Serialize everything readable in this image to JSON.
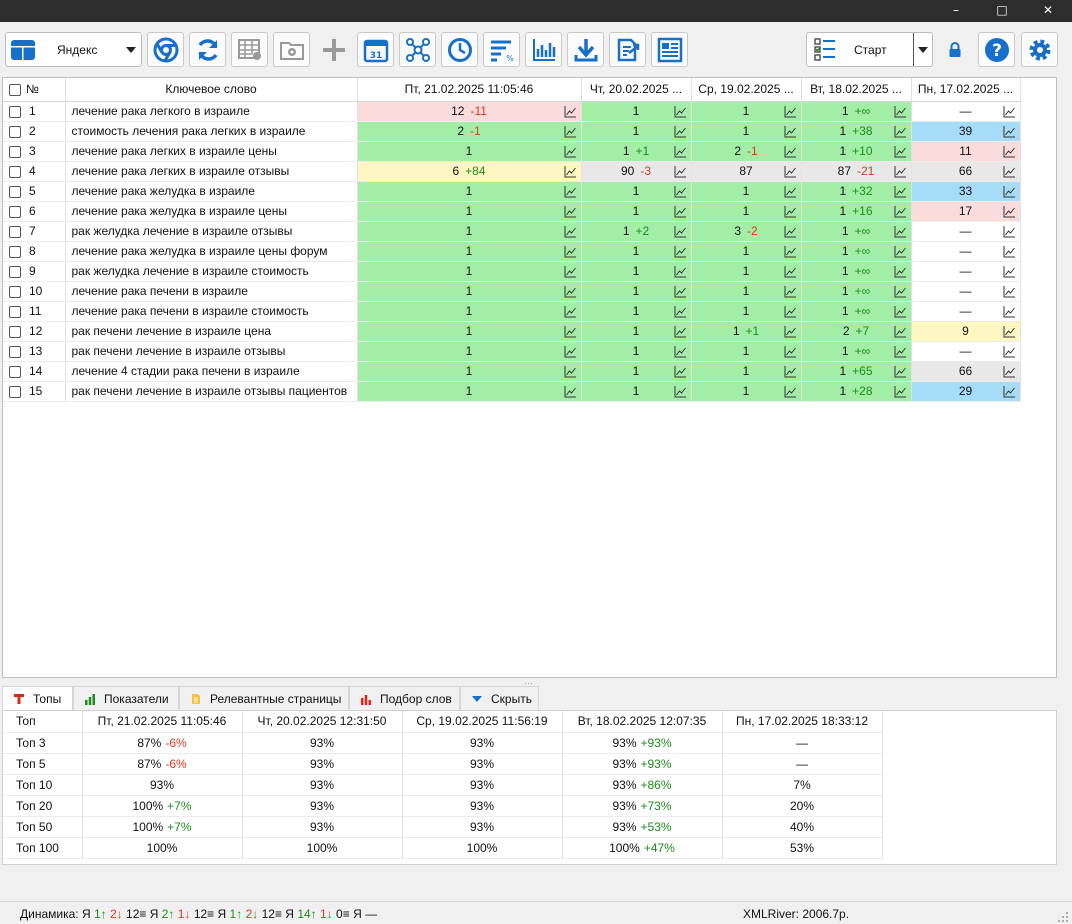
{
  "window": {
    "minimize": "–",
    "maximize": "□",
    "close": "✕"
  },
  "toolbar": {
    "engine": "Яндекс",
    "start": "Старт",
    "colors": {
      "blue": "#1670c9",
      "gray": "#9a9a9a"
    }
  },
  "grid": {
    "headers": {
      "num": "№",
      "keyword": "Ключевое слово",
      "dates": [
        "Пт, 21.02.2025 11:05:46",
        "Чт, 20.02.2025 ...",
        "Ср, 19.02.2025 ...",
        "Вт, 18.02.2025 ...",
        "Пн, 17.02.2025 ..."
      ]
    },
    "rows": [
      {
        "n": "1",
        "kw": "лечение рака легкого в израиле",
        "c": [
          {
            "v": "12",
            "d": "-11",
            "bg": "r"
          },
          {
            "v": "1",
            "d": "",
            "bg": "g"
          },
          {
            "v": "1",
            "d": "",
            "bg": "g"
          },
          {
            "v": "1",
            "d": "+∞",
            "bg": "g"
          },
          {
            "v": "—",
            "d": "",
            "bg": "w"
          }
        ]
      },
      {
        "n": "2",
        "kw": "стоимость лечения рака легких в израиле",
        "c": [
          {
            "v": "2",
            "d": "-1",
            "bg": "g"
          },
          {
            "v": "1",
            "d": "",
            "bg": "g"
          },
          {
            "v": "1",
            "d": "",
            "bg": "g"
          },
          {
            "v": "1",
            "d": "+38",
            "bg": "g"
          },
          {
            "v": "39",
            "d": "",
            "bg": "b"
          }
        ]
      },
      {
        "n": "3",
        "kw": "лечение рака легких в израиле цены",
        "c": [
          {
            "v": "1",
            "d": "",
            "bg": "g"
          },
          {
            "v": "1",
            "d": "+1",
            "bg": "g"
          },
          {
            "v": "2",
            "d": "-1",
            "bg": "g"
          },
          {
            "v": "1",
            "d": "+10",
            "bg": "g"
          },
          {
            "v": "11",
            "d": "",
            "bg": "r"
          }
        ]
      },
      {
        "n": "4",
        "kw": "лечение рака легких в израиле отзывы",
        "c": [
          {
            "v": "6",
            "d": "+84",
            "bg": "y"
          },
          {
            "v": "90",
            "d": "-3",
            "bg": "gr"
          },
          {
            "v": "87",
            "d": "",
            "bg": "gr"
          },
          {
            "v": "87",
            "d": "-21",
            "bg": "gr"
          },
          {
            "v": "66",
            "d": "",
            "bg": "gr"
          }
        ]
      },
      {
        "n": "5",
        "kw": "лечение рака желудка в израиле",
        "c": [
          {
            "v": "1",
            "d": "",
            "bg": "g"
          },
          {
            "v": "1",
            "d": "",
            "bg": "g"
          },
          {
            "v": "1",
            "d": "",
            "bg": "g"
          },
          {
            "v": "1",
            "d": "+32",
            "bg": "g"
          },
          {
            "v": "33",
            "d": "",
            "bg": "b"
          }
        ]
      },
      {
        "n": "6",
        "kw": "лечение рака желудка в израиле цены",
        "c": [
          {
            "v": "1",
            "d": "",
            "bg": "g"
          },
          {
            "v": "1",
            "d": "",
            "bg": "g"
          },
          {
            "v": "1",
            "d": "",
            "bg": "g"
          },
          {
            "v": "1",
            "d": "+16",
            "bg": "g"
          },
          {
            "v": "17",
            "d": "",
            "bg": "r"
          }
        ]
      },
      {
        "n": "7",
        "kw": "рак желудка лечение в израиле отзывы",
        "c": [
          {
            "v": "1",
            "d": "",
            "bg": "g"
          },
          {
            "v": "1",
            "d": "+2",
            "bg": "g"
          },
          {
            "v": "3",
            "d": "-2",
            "bg": "g"
          },
          {
            "v": "1",
            "d": "+∞",
            "bg": "g"
          },
          {
            "v": "—",
            "d": "",
            "bg": "w"
          }
        ]
      },
      {
        "n": "8",
        "kw": "лечение рака желудка в израиле цены форум",
        "c": [
          {
            "v": "1",
            "d": "",
            "bg": "g"
          },
          {
            "v": "1",
            "d": "",
            "bg": "g"
          },
          {
            "v": "1",
            "d": "",
            "bg": "g"
          },
          {
            "v": "1",
            "d": "+∞",
            "bg": "g"
          },
          {
            "v": "—",
            "d": "",
            "bg": "w"
          }
        ]
      },
      {
        "n": "9",
        "kw": "рак желудка лечение в израиле стоимость",
        "c": [
          {
            "v": "1",
            "d": "",
            "bg": "g"
          },
          {
            "v": "1",
            "d": "",
            "bg": "g"
          },
          {
            "v": "1",
            "d": "",
            "bg": "g"
          },
          {
            "v": "1",
            "d": "+∞",
            "bg": "g"
          },
          {
            "v": "—",
            "d": "",
            "bg": "w"
          }
        ]
      },
      {
        "n": "10",
        "kw": "лечение рака печени в израиле",
        "c": [
          {
            "v": "1",
            "d": "",
            "bg": "g"
          },
          {
            "v": "1",
            "d": "",
            "bg": "g"
          },
          {
            "v": "1",
            "d": "",
            "bg": "g"
          },
          {
            "v": "1",
            "d": "+∞",
            "bg": "g"
          },
          {
            "v": "—",
            "d": "",
            "bg": "w"
          }
        ]
      },
      {
        "n": "11",
        "kw": "лечение рака печени в израиле стоимость",
        "c": [
          {
            "v": "1",
            "d": "",
            "bg": "g"
          },
          {
            "v": "1",
            "d": "",
            "bg": "g"
          },
          {
            "v": "1",
            "d": "",
            "bg": "g"
          },
          {
            "v": "1",
            "d": "+∞",
            "bg": "g"
          },
          {
            "v": "—",
            "d": "",
            "bg": "w"
          }
        ]
      },
      {
        "n": "12",
        "kw": "рак печени лечение в израиле цена",
        "c": [
          {
            "v": "1",
            "d": "",
            "bg": "g"
          },
          {
            "v": "1",
            "d": "",
            "bg": "g"
          },
          {
            "v": "1",
            "d": "+1",
            "bg": "g"
          },
          {
            "v": "2",
            "d": "+7",
            "bg": "g"
          },
          {
            "v": "9",
            "d": "",
            "bg": "y"
          }
        ]
      },
      {
        "n": "13",
        "kw": "рак печени лечение в израиле отзывы",
        "c": [
          {
            "v": "1",
            "d": "",
            "bg": "g"
          },
          {
            "v": "1",
            "d": "",
            "bg": "g"
          },
          {
            "v": "1",
            "d": "",
            "bg": "g"
          },
          {
            "v": "1",
            "d": "+∞",
            "bg": "g"
          },
          {
            "v": "—",
            "d": "",
            "bg": "w"
          }
        ]
      },
      {
        "n": "14",
        "kw": "лечение 4 стадии рака печени в израиле",
        "c": [
          {
            "v": "1",
            "d": "",
            "bg": "g"
          },
          {
            "v": "1",
            "d": "",
            "bg": "g"
          },
          {
            "v": "1",
            "d": "",
            "bg": "g"
          },
          {
            "v": "1",
            "d": "+65",
            "bg": "g"
          },
          {
            "v": "66",
            "d": "",
            "bg": "gr"
          }
        ]
      },
      {
        "n": "15",
        "kw": "рак печени лечение в израиле отзывы пациентов",
        "c": [
          {
            "v": "1",
            "d": "",
            "bg": "g"
          },
          {
            "v": "1",
            "d": "",
            "bg": "g"
          },
          {
            "v": "1",
            "d": "",
            "bg": "g"
          },
          {
            "v": "1",
            "d": "+28",
            "bg": "g"
          },
          {
            "v": "29",
            "d": "",
            "bg": "b"
          }
        ]
      }
    ]
  },
  "tabs": [
    {
      "label": "Топы",
      "icon": "top-icon"
    },
    {
      "label": "Показатели",
      "icon": "bar-chart-icon"
    },
    {
      "label": "Релевантные страницы",
      "icon": "document-icon"
    },
    {
      "label": "Подбор слов",
      "icon": "bar-chart-red-icon"
    },
    {
      "label": "Скрыть",
      "icon": "chevron-down-icon"
    }
  ],
  "tops": {
    "headers": [
      "Топ",
      "Пт, 21.02.2025 11:05:46",
      "Чт, 20.02.2025 12:31:50",
      "Ср, 19.02.2025 11:56:19",
      "Вт, 18.02.2025 12:07:35",
      "Пн, 17.02.2025 18:33:12"
    ],
    "rows": [
      {
        "label": "Топ 3",
        "c": [
          {
            "v": "87%",
            "d": "-6%"
          },
          {
            "v": "93%",
            "d": ""
          },
          {
            "v": "93%",
            "d": ""
          },
          {
            "v": "93%",
            "d": "+93%"
          },
          {
            "v": "—",
            "d": ""
          }
        ]
      },
      {
        "label": "Топ 5",
        "c": [
          {
            "v": "87%",
            "d": "-6%"
          },
          {
            "v": "93%",
            "d": ""
          },
          {
            "v": "93%",
            "d": ""
          },
          {
            "v": "93%",
            "d": "+93%"
          },
          {
            "v": "—",
            "d": ""
          }
        ]
      },
      {
        "label": "Топ 10",
        "c": [
          {
            "v": "93%",
            "d": ""
          },
          {
            "v": "93%",
            "d": ""
          },
          {
            "v": "93%",
            "d": ""
          },
          {
            "v": "93%",
            "d": "+86%"
          },
          {
            "v": "7%",
            "d": ""
          }
        ]
      },
      {
        "label": "Топ 20",
        "c": [
          {
            "v": "100%",
            "d": "+7%"
          },
          {
            "v": "93%",
            "d": ""
          },
          {
            "v": "93%",
            "d": ""
          },
          {
            "v": "93%",
            "d": "+73%"
          },
          {
            "v": "20%",
            "d": ""
          }
        ]
      },
      {
        "label": "Топ 50",
        "c": [
          {
            "v": "100%",
            "d": "+7%"
          },
          {
            "v": "93%",
            "d": ""
          },
          {
            "v": "93%",
            "d": ""
          },
          {
            "v": "93%",
            "d": "+53%"
          },
          {
            "v": "40%",
            "d": ""
          }
        ]
      },
      {
        "label": "Топ 100",
        "c": [
          {
            "v": "100%",
            "d": ""
          },
          {
            "v": "100%",
            "d": ""
          },
          {
            "v": "100%",
            "d": ""
          },
          {
            "v": "100%",
            "d": "+47%"
          },
          {
            "v": "53%",
            "d": ""
          }
        ]
      }
    ]
  },
  "status": {
    "label": "Динамика:",
    "groups": [
      {
        "e": "Я",
        "up": "1↑",
        "down": "2↓",
        "eq": "12≡"
      },
      {
        "e": "Я",
        "up": "2↑",
        "down": "1↓",
        "eq": "12≡"
      },
      {
        "e": "Я",
        "up": "1↑",
        "down": "2↓",
        "eq": "12≡"
      },
      {
        "e": "Я",
        "up": "14↑",
        "down": "1↓",
        "eq": "0≡"
      }
    ],
    "tail": "Я —",
    "balance": "XMLRiver: 2006.7р."
  }
}
